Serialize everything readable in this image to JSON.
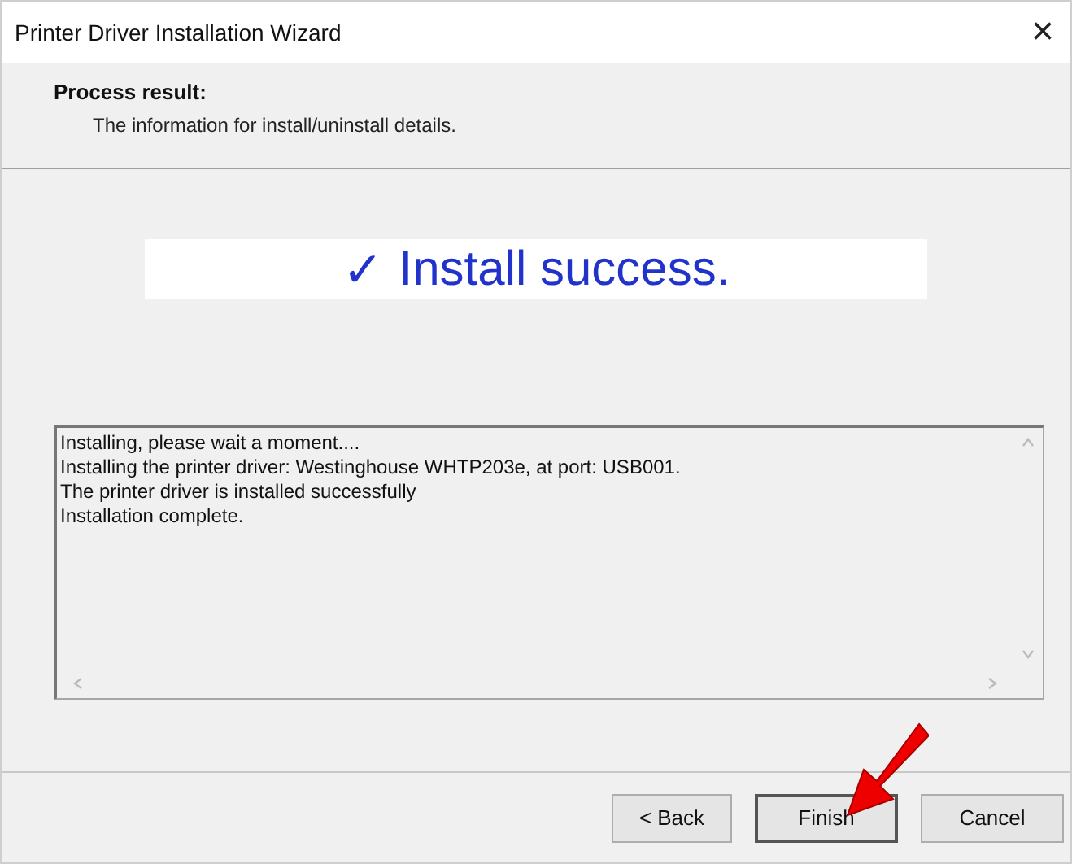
{
  "window": {
    "title": "Printer Driver Installation Wizard",
    "close": "×"
  },
  "header": {
    "title": "Process result:",
    "subtitle": "The information for install/uninstall details."
  },
  "banner": {
    "mark": "✓",
    "text": "Install success."
  },
  "log": {
    "lines": [
      "Installing, please wait a moment....",
      "Installing the printer driver: Westinghouse WHTP203e, at port: USB001.",
      "The printer driver is installed successfully",
      "Installation complete."
    ]
  },
  "buttons": [
    {
      "label": "< Back",
      "default": false
    },
    {
      "label": "Finish",
      "default": true
    },
    {
      "label": "Cancel",
      "default": false
    }
  ]
}
